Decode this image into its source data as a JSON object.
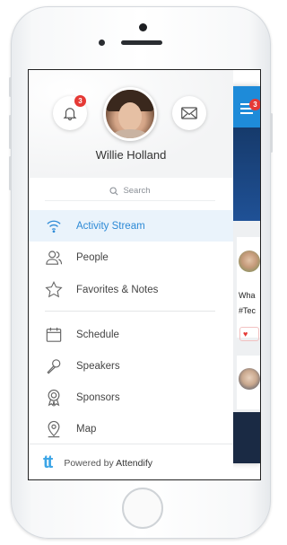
{
  "profile": {
    "name": "Willie Holland",
    "notifications_count": "3"
  },
  "search": {
    "placeholder": "Search"
  },
  "nav": {
    "items": [
      {
        "label": "Activity Stream",
        "icon": "wifi-icon",
        "active": true
      },
      {
        "label": "People",
        "icon": "people-icon"
      },
      {
        "label": "Favorites & Notes",
        "icon": "star-icon"
      },
      {
        "label": "Schedule",
        "icon": "calendar-icon"
      },
      {
        "label": "Speakers",
        "icon": "microphone-icon"
      },
      {
        "label": "Sponsors",
        "icon": "award-icon"
      },
      {
        "label": "Map",
        "icon": "map-pin-icon"
      }
    ]
  },
  "footer": {
    "logo": "tt",
    "powered_by": "Powered by",
    "brand": "Attendify"
  },
  "peek": {
    "menu_badge": "3",
    "post_text_1": "Wha",
    "post_text_2": "#Tec"
  },
  "colors": {
    "accent": "#2d8ad6",
    "active_bg": "#eaf3fb",
    "badge": "#e53935",
    "header_blue": "#1e8bd9"
  }
}
